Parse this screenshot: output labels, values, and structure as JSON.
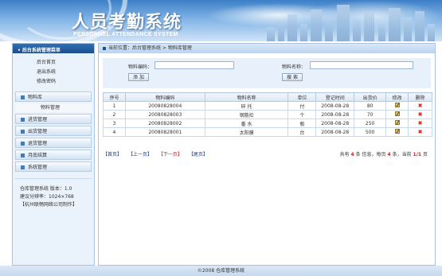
{
  "header": {
    "title_cn": "人员考勤系统",
    "title_en": "PERSONNEL ATTENDANCE SYSTEM"
  },
  "sidebar": {
    "title": "• 后台系统管理菜单",
    "links": [
      "后台首页",
      "退出系统",
      "修改密码"
    ],
    "groups": [
      {
        "label": "物料库",
        "sub": [
          "物料管理"
        ]
      },
      {
        "label": "进货管理"
      },
      {
        "label": "出货管理"
      },
      {
        "label": "退货管理"
      },
      {
        "label": "月底结算"
      },
      {
        "label": "系统管理"
      }
    ],
    "info": [
      "仓库管理系统 版本：1.0",
      "建议分辨率：1024×768",
      "【杭州联畅网络公司制作】"
    ]
  },
  "breadcrumb": "当前位置：后台管理系统 > 物料库管理",
  "search": {
    "code_label": "物料编码：",
    "code_value": "",
    "name_label": "物料名称：",
    "name_value": "",
    "add_label": "添 加",
    "search_label": "搜 索"
  },
  "table": {
    "headers": [
      "序号",
      "物料编码",
      "物料名称",
      "单位",
      "登记时间",
      "出货价",
      "修改",
      "删除"
    ],
    "rows": [
      [
        "1",
        "20080828004",
        "碎 托",
        "付",
        "2008-08-28",
        "80"
      ],
      [
        "2",
        "20080828003",
        "钢筋扣",
        "个",
        "2008-08-28",
        "70"
      ],
      [
        "3",
        "20080828002",
        "番 水",
        "瓶",
        "2008-08-28",
        "250"
      ],
      [
        "4",
        "20080828001",
        "太阳膜",
        "台",
        "2008-08-28",
        "500"
      ]
    ]
  },
  "pager": {
    "first": "【首页】",
    "prev": "【上一页】",
    "next": "【下一页】",
    "last": "【尾页】",
    "info_prefix": "共有",
    "total": "4",
    "info_mid1": "条 信息，每页",
    "per_page": "4",
    "info_mid2": "条，当前",
    "current": "1/1",
    "info_suffix": "页"
  },
  "footer": "©2008 仓库管理系统"
}
